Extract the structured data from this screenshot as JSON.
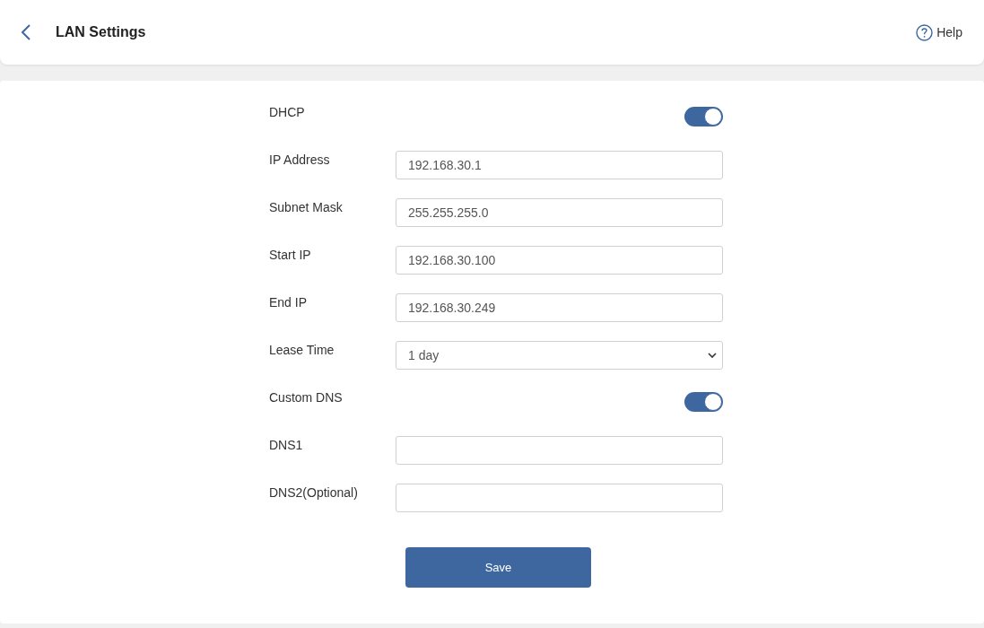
{
  "header": {
    "title": "LAN Settings",
    "help": "Help"
  },
  "fields": [
    {
      "kind": "toggle",
      "label": "DHCP",
      "on": true
    },
    {
      "kind": "text",
      "label": "IP Address",
      "value": "192.168.30.1"
    },
    {
      "kind": "text",
      "label": "Subnet Mask",
      "value": "255.255.255.0"
    },
    {
      "kind": "text",
      "label": "Start IP",
      "value": "192.168.30.100"
    },
    {
      "kind": "text",
      "label": "End IP",
      "value": "192.168.30.249"
    },
    {
      "kind": "select",
      "label": "Lease Time",
      "value": "1 day"
    },
    {
      "kind": "toggle",
      "label": "Custom DNS",
      "on": true
    },
    {
      "kind": "text",
      "label": "DNS1"
    },
    {
      "kind": "text",
      "label": "DNS2(Optional)"
    }
  ],
  "save_button": "Save"
}
